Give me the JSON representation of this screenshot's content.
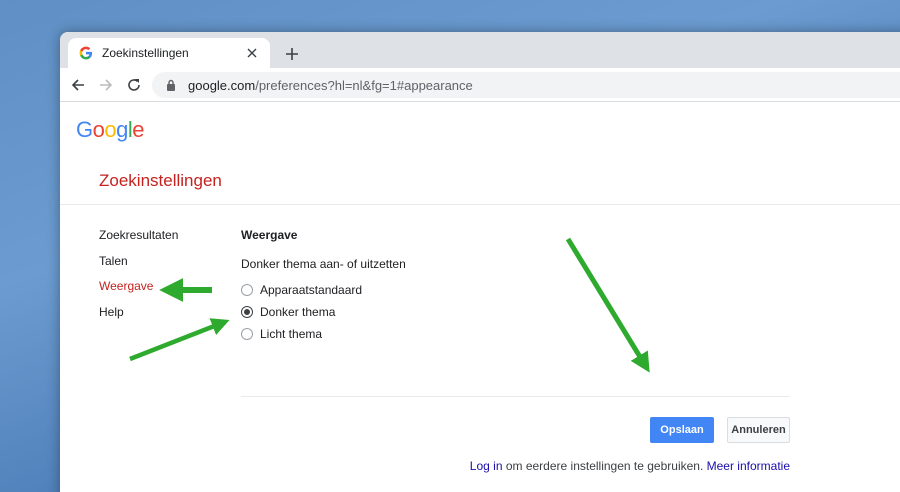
{
  "browser": {
    "tab_title": "Zoekinstellingen",
    "url_host": "google.com",
    "url_rest": "/preferences?hl=nl&fg=1#appearance"
  },
  "logo": {
    "letters": [
      "G",
      "o",
      "o",
      "g",
      "l",
      "e"
    ],
    "colors": [
      "#4285f4",
      "#ea4335",
      "#fbbc05",
      "#4285f4",
      "#34a853",
      "#ea4335"
    ]
  },
  "page": {
    "title": "Zoekinstellingen"
  },
  "sidebar": {
    "items": [
      {
        "label": "Zoekresultaten",
        "active": false
      },
      {
        "label": "Talen",
        "active": false
      },
      {
        "label": "Weergave",
        "active": true
      },
      {
        "label": "Help",
        "active": false
      }
    ]
  },
  "section": {
    "title": "Weergave",
    "description": "Donker thema aan- of uitzetten",
    "options": [
      {
        "label": "Apparaatstandaard",
        "selected": false
      },
      {
        "label": "Donker thema",
        "selected": true
      },
      {
        "label": "Licht thema",
        "selected": false
      }
    ]
  },
  "buttons": {
    "save": "Opslaan",
    "cancel": "Annuleren"
  },
  "footer": {
    "login": "Log in",
    "middle": " om eerdere instellingen te gebruiken. ",
    "more": "Meer informatie"
  },
  "colors": {
    "accent_red": "#c5221f",
    "save_blue": "#4285f4",
    "link_blue": "#1a0dab",
    "annotation_green": "#2eaa2e"
  }
}
